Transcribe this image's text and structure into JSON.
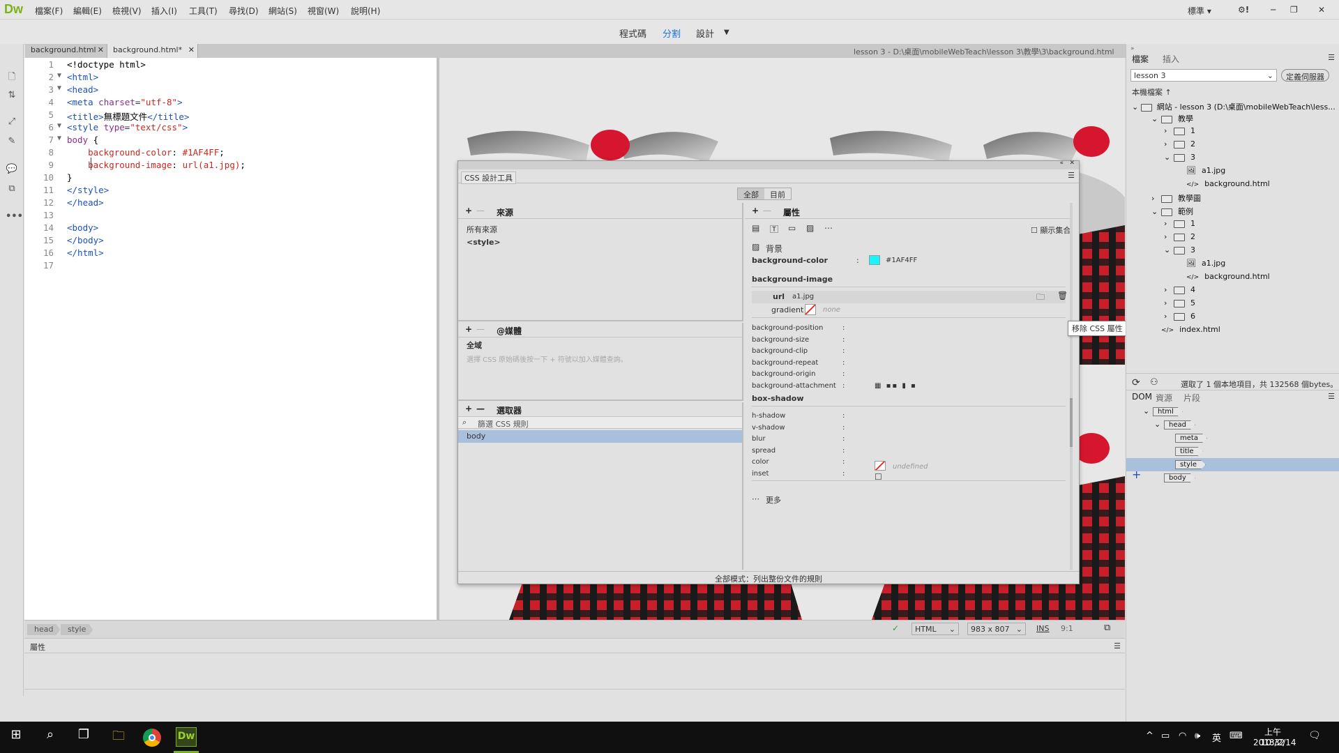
{
  "app": {
    "logo": "Dw"
  },
  "menu": [
    "檔案(F)",
    "編輯(E)",
    "檢視(V)",
    "插入(I)",
    "工具(T)",
    "尋找(D)",
    "網站(S)",
    "視窗(W)",
    "說明(H)"
  ],
  "window_controls": {
    "workspace": "標準",
    "workspace_arrow": "▾",
    "gear": "⚙!",
    "min": "─",
    "max": "❐",
    "close": "✕"
  },
  "view_modes": {
    "code": "程式碼",
    "split": "分割",
    "design": "設計"
  },
  "doc_tabs": [
    {
      "label": "background.html"
    },
    {
      "label": "background.html*"
    }
  ],
  "doc_path": "lesson 3 - D:\\桌面\\mobileWebTeach\\lesson 3\\教學\\3\\background.html",
  "code_lines": [
    {
      "n": "1",
      "fold": "",
      "html": "<span class='txt'>&lt;!doctype html&gt;</span>"
    },
    {
      "n": "2",
      "fold": "▼",
      "html": "<span class='tag'>&lt;html&gt;</span>"
    },
    {
      "n": "3",
      "fold": "▼",
      "html": "<span class='tag'>&lt;head&gt;</span>"
    },
    {
      "n": "4",
      "fold": "",
      "html": "<span class='tag'>&lt;meta</span> <span class='attr'>charset</span>=<span class='str'>\"utf-8\"</span><span class='tag'>&gt;</span>"
    },
    {
      "n": "5",
      "fold": "",
      "html": "<span class='tag'>&lt;title&gt;</span><span class='txt'>無標題文件</span><span class='tag'>&lt;/title&gt;</span>"
    },
    {
      "n": "6",
      "fold": "▼",
      "html": "<span class='tag'>&lt;style</span> <span class='attr'>type</span>=<span class='str'>\"text/css\"</span><span class='tag'>&gt;</span>"
    },
    {
      "n": "7",
      "fold": "▼",
      "html": "<span class='sel'>body</span> <span class='txt'>{</span>"
    },
    {
      "n": "8",
      "fold": "",
      "html": "    <span class='prop'>background-color</span><span class='txt'>:</span> <span class='str'>#1AF4FF</span><span class='txt'>;</span>"
    },
    {
      "n": "9",
      "fold": "",
      "html": "    <span class='prop'>background-image</span><span class='txt'>:</span> <span class='str'>url(a1.jpg)</span><span class='txt'>;</span>"
    },
    {
      "n": "10",
      "fold": "",
      "html": "<span class='txt'>}</span>"
    },
    {
      "n": "11",
      "fold": "",
      "html": "<span class='tag'>&lt;/style&gt;</span>"
    },
    {
      "n": "12",
      "fold": "",
      "html": "<span class='tag'>&lt;/head&gt;</span>"
    },
    {
      "n": "13",
      "fold": "",
      "html": ""
    },
    {
      "n": "14",
      "fold": "",
      "html": "<span class='tag'>&lt;body&gt;</span>"
    },
    {
      "n": "15",
      "fold": "",
      "html": "<span class='tag'>&lt;/body&gt;</span>"
    },
    {
      "n": "16",
      "fold": "",
      "html": "<span class='tag'>&lt;/html&gt;</span>"
    },
    {
      "n": "17",
      "fold": "",
      "html": ""
    }
  ],
  "css_designer": {
    "title": "CSS 設計工具",
    "toggle_all": "全部",
    "toggle_current": "目前",
    "sources_label": "來源",
    "sources": [
      "所有來源",
      "<style>"
    ],
    "media_label": "@媒體",
    "media_global": "全域",
    "media_hint": "選擇 CSS 原始碼後按一下 + 符號以加入媒體查詢。",
    "selectors_label": "選取器",
    "selector_filter_placeholder": "篩選 CSS 規則",
    "selectors": [
      "body"
    ],
    "properties_label": "屬性",
    "show_set": "顯示集合",
    "bg_section": "背景",
    "bg_color_label": "background-color",
    "bg_color_value": "#1AF4FF",
    "bg_color_swatch": "#1AF4FF",
    "bg_image_label": "background-image",
    "url_label": "url",
    "url_value": "a1.jpg",
    "gradient_label": "gradient",
    "gradient_value": "none",
    "tooltip": "移除 CSS 屬性",
    "bg_props": [
      "background-position",
      "background-size",
      "background-clip",
      "background-repeat",
      "background-origin",
      "background-attachment"
    ],
    "box_shadow_label": "box-shadow",
    "shadow_props": [
      "h-shadow",
      "v-shadow",
      "blur",
      "spread",
      "color",
      "inset"
    ],
    "shadow_color_value": "undefined",
    "more_label": "更多",
    "footer": "全部模式：列出整份文件的規則"
  },
  "files_panel": {
    "tab_files": "檔案",
    "tab_insert": "插入",
    "site_select": "lesson 3",
    "define_server": "定義伺服器",
    "local_files": "本機檔案 ↑",
    "site_root": "網站 - lesson 3 (D:\\桌面\\mobileWebTeach\\less...",
    "tree": [
      {
        "depth": 1,
        "arrow": "⌄",
        "kind": "folder",
        "label": "教學"
      },
      {
        "depth": 2,
        "arrow": "›",
        "kind": "folder",
        "label": "1"
      },
      {
        "depth": 2,
        "arrow": "›",
        "kind": "folder",
        "label": "2"
      },
      {
        "depth": 2,
        "arrow": "⌄",
        "kind": "folder",
        "label": "3"
      },
      {
        "depth": 3,
        "arrow": "",
        "kind": "image",
        "label": "a1.jpg"
      },
      {
        "depth": 3,
        "arrow": "",
        "kind": "code",
        "label": "background.html"
      },
      {
        "depth": 1,
        "arrow": "›",
        "kind": "folder",
        "label": "教學圖"
      },
      {
        "depth": 1,
        "arrow": "⌄",
        "kind": "folder",
        "label": "範例"
      },
      {
        "depth": 2,
        "arrow": "›",
        "kind": "folder",
        "label": "1"
      },
      {
        "depth": 2,
        "arrow": "›",
        "kind": "folder",
        "label": "2"
      },
      {
        "depth": 2,
        "arrow": "⌄",
        "kind": "folder",
        "label": "3"
      },
      {
        "depth": 3,
        "arrow": "",
        "kind": "image",
        "label": "a1.jpg"
      },
      {
        "depth": 3,
        "arrow": "",
        "kind": "code",
        "label": "background.html"
      },
      {
        "depth": 2,
        "arrow": "›",
        "kind": "folder",
        "label": "4"
      },
      {
        "depth": 2,
        "arrow": "›",
        "kind": "folder",
        "label": "5"
      },
      {
        "depth": 2,
        "arrow": "›",
        "kind": "folder",
        "label": "6"
      },
      {
        "depth": 1,
        "arrow": "",
        "kind": "code",
        "label": "index.html"
      }
    ],
    "status": "選取了 1 個本地項目，共 132568 個bytes。"
  },
  "dom_panel": {
    "tabs": [
      "DOM",
      "資源",
      "片段"
    ],
    "nodes": [
      {
        "depth": 0,
        "arrow": "⌄",
        "label": "html",
        "selected": false
      },
      {
        "depth": 1,
        "arrow": "⌄",
        "label": "head",
        "selected": false
      },
      {
        "depth": 2,
        "arrow": "",
        "label": "meta",
        "selected": false
      },
      {
        "depth": 2,
        "arrow": "",
        "label": "title",
        "selected": false
      },
      {
        "depth": 2,
        "arrow": "",
        "label": "style",
        "selected": true
      },
      {
        "depth": 1,
        "arrow": "",
        "label": "body",
        "selected": false
      }
    ]
  },
  "status_bar": {
    "crumbs": [
      "head",
      "style"
    ],
    "doc_type": "HTML",
    "size": "983 x 807",
    "ins": "INS",
    "pos": "9:1"
  },
  "properties_panel": {
    "title": "屬性"
  },
  "taskbar": {
    "time": "上午 10:32",
    "date": "2018/2/14",
    "ime": "英",
    "dw_label": "Dw"
  }
}
